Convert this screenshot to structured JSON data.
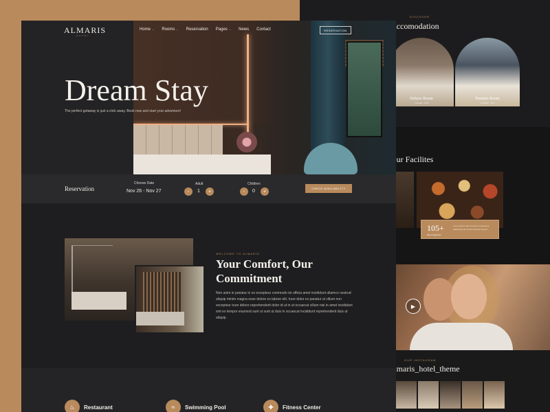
{
  "nav": {
    "logo": "ALMARIS",
    "logo_sub": "HOTEL",
    "items": [
      "Home",
      "Rooms",
      "Reservation",
      "Pages",
      "News",
      "Contact"
    ],
    "cta": "RESERVATION"
  },
  "hero": {
    "title": "Dream Stay",
    "subtitle": "The perfect getaway is just a click away. Book now and start your adventure!"
  },
  "reservation": {
    "label": "Reservation",
    "date_title": "Choose Date",
    "date_value": "Nov 26 - Nov 27",
    "adult_title": "Adult",
    "adult_value": "1",
    "children_title": "Children",
    "children_value": "0",
    "minus": "-",
    "plus": "+",
    "check_button": "CHECK AVAILABILITY"
  },
  "about": {
    "tag": "WELCOME TO ALMARIS",
    "title": "Your Comfort, Our Commitment",
    "body": "Non anim in pariatur in ex excepteur commodo do officia amet incididunt ullamco nostrud aliquip minim magna esse dolore ex labore elit. Irure dolor ex pariatur ut cillum non excepteur irure dolore reprehenderit dolor id ut in ut occaecat cillum nisi in amet incididunt sint ex tempor eiusmod sunt ut sunt ut duis in occaecat incididunt reprehenderit duis ut aliquip."
  },
  "services": [
    {
      "label": "Restaurant",
      "icon": "restaurant-icon",
      "glyph": "♨"
    },
    {
      "label": "Swimming Pool",
      "icon": "pool-icon",
      "glyph": "≈"
    },
    {
      "label": "Fitness Center",
      "icon": "fitness-icon",
      "glyph": "✚"
    }
  ],
  "accommodation": {
    "tag": "DISCOVER",
    "title": "Accomodation",
    "rooms": [
      {
        "name": "Deluxe Room",
        "guests": "2 Guests · 35 ft"
      },
      {
        "name": "Premier Room",
        "guests": "2 Guests · 40 ft"
      }
    ]
  },
  "facilities": {
    "title": "Our Facilites",
    "stat_number": "105+",
    "stat_label": "Menu Selection",
    "stat_desc": "Lorem ipsum dolor sit amet consectetur adipiscing elit sed do eiusmod tempor"
  },
  "instagram": {
    "tag": "OUR INSTAGRAM",
    "handle": "almaris_hotel_theme"
  },
  "colors": {
    "accent": "#b88a5c",
    "background": "#1e1e20",
    "frame": "#b88a5c"
  }
}
